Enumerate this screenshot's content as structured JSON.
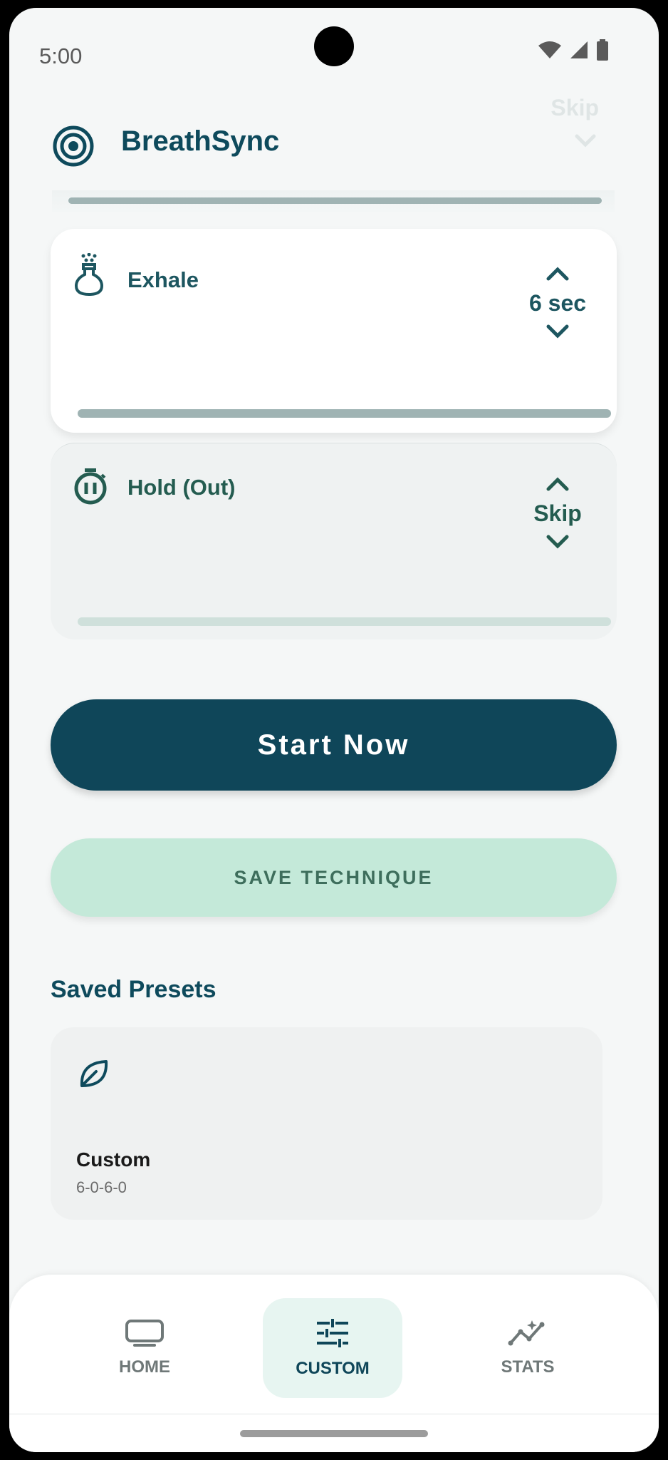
{
  "status_bar": {
    "time": "5:00"
  },
  "header": {
    "title": "BreathSync",
    "faded_value": "Skip"
  },
  "phases": [
    {
      "label": "Exhale",
      "value": "6 sec"
    },
    {
      "label": "Hold (Out)",
      "value": "Skip"
    }
  ],
  "buttons": {
    "start": "Start Now",
    "save": "SAVE TECHNIQUE"
  },
  "presets": {
    "title": "Saved Presets",
    "items": [
      {
        "name": "Custom",
        "pattern": "6-0-6-0"
      }
    ]
  },
  "nav": {
    "items": [
      {
        "label": "HOME",
        "icon": "tv-icon"
      },
      {
        "label": "CUSTOM",
        "icon": "tune-icon",
        "active": true
      },
      {
        "label": "STATS",
        "icon": "insights-icon"
      }
    ]
  },
  "colors": {
    "primary": "#0f4659",
    "accent_soft": "#c4e9d9",
    "text_green": "#245c50"
  }
}
